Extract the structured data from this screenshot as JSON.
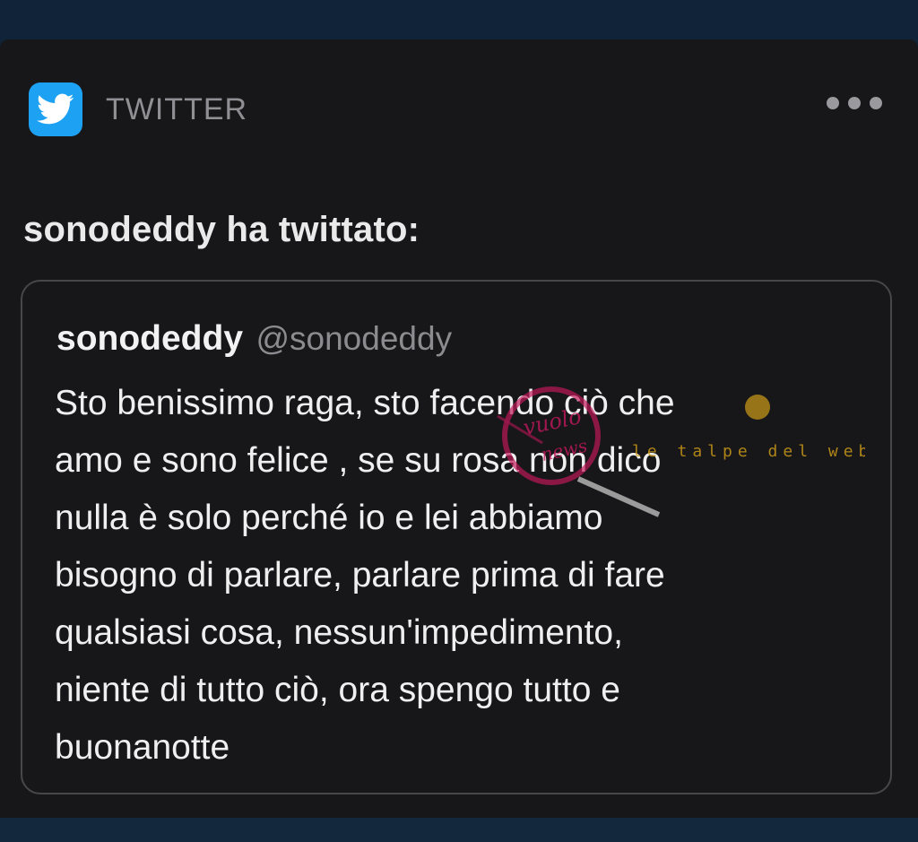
{
  "app": {
    "name": "TWITTER",
    "icon": "twitter-bird-icon",
    "accent_color": "#1da1f2"
  },
  "post": {
    "title": "sonodeddy ha twittato:"
  },
  "tweet": {
    "display_name": "sonodeddy",
    "handle": "@sonodeddy",
    "text": "Sto benissimo raga, sto facendo ciò che\namo e sono felice , se su rosa non dico\nnulla è solo perché io e lei abbiamo\nbisogno di parlare, parlare prima di fare\nqualsiasi cosa, nessun'impedimento,\nniente di tutto ciò, ora spengo tutto e\nbuonanotte"
  },
  "watermark": {
    "text": "le talpe del web"
  },
  "icons": {
    "more": "more-horizontal-icon"
  }
}
